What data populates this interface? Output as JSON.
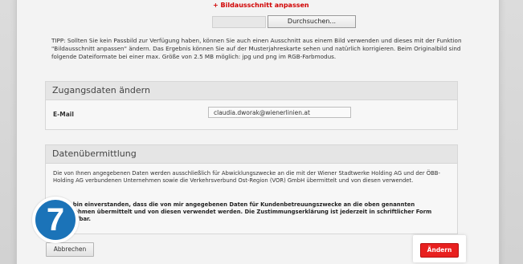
{
  "upload": {
    "crop_link": "+ Bildausschnitt anpassen",
    "browse_label": "Durchsuchen..."
  },
  "tip": {
    "text": "TIPP: Sollten Sie kein Passbild zur Verfügung haben, können Sie auch einen Ausschnitt aus einem Bild verwenden und dieses mit der Funktion \"Bildausschnitt anpassen\" ändern. Das Ergebnis können Sie auf der Musterjahreskarte sehen und natürlich korrigieren. Beim Originalbild sind folgende Dateiformate bei einer max. Größe von 2.5 MB möglich: jpg und png im RGB-Farbmodus."
  },
  "access": {
    "title": "Zugangsdaten ändern",
    "email_label": "E-Mail",
    "email_value": "claudia.dworak@wienerlinien.at"
  },
  "privacy": {
    "title": "Datenübermittlung",
    "text": "Die von Ihnen angegebenen Daten werden ausschließlich für Abwicklungszwecke an die mit der Wiener Stadtwerke Holding AG und der ÖBB-Holding AG verbundenen Unternehmen sowie die Verkehrsverbund Ost-Region (VOR) GmbH übermittelt und von diesen verwendet.",
    "consent": "Ich bin einverstanden, dass die von mir angegebenen Daten für Kundenbetreuungszwecke an die oben genannten Unternehmen übermittelt und von diesen verwendet werden. Die Zustimmungserklärung ist jederzeit in schriftlicher Form widerrufbar."
  },
  "actions": {
    "cancel_label": "Abbrechen",
    "submit_label": "Ändern"
  },
  "overlay": {
    "step_number": "7"
  },
  "colors": {
    "accent_red": "#e8201f",
    "badge_blue": "#1b73b8"
  }
}
